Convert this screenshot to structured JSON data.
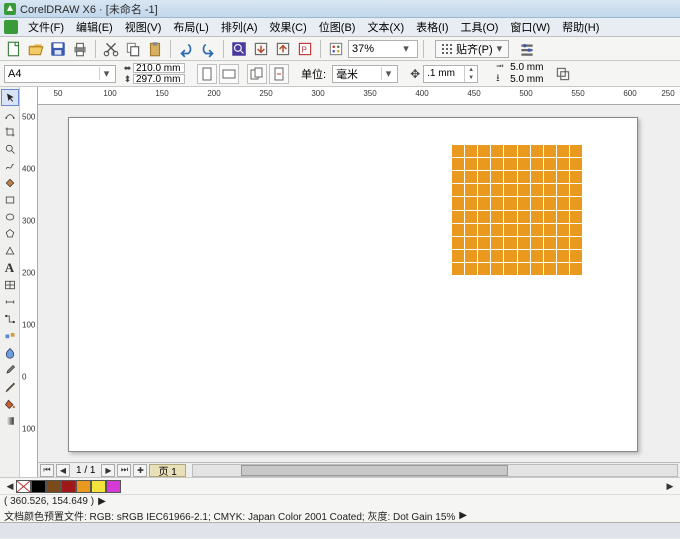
{
  "title": "CorelDRAW X6 · [未命名 -1]",
  "menus": [
    "文件(F)",
    "编辑(E)",
    "视图(V)",
    "布局(L)",
    "排列(A)",
    "效果(C)",
    "位图(B)",
    "文本(X)",
    "表格(I)",
    "工具(O)",
    "窗口(W)",
    "帮助(H)"
  ],
  "zoom": "37%",
  "align_label": "贴齐(P)",
  "paper_combo": "A4",
  "page_w": "210.0 mm",
  "page_h": "297.0 mm",
  "units_label": "单位:",
  "units_value": "毫米",
  "nudge": ".1 mm",
  "dup_x": "5.0 mm",
  "dup_y": "5.0 mm",
  "rulerH": [
    "50",
    "100",
    "150",
    "200",
    "250",
    "300",
    "350",
    "400",
    "450",
    "500",
    "550",
    "600",
    "250"
  ],
  "rulerHp": [
    58,
    110,
    162,
    214,
    266,
    318,
    370,
    422,
    474,
    526,
    578,
    620,
    660
  ],
  "rulerV": [
    "500",
    "400",
    "300",
    "200",
    "100",
    "0",
    "100"
  ],
  "rulerVp": [
    30,
    82,
    134,
    186,
    238,
    290,
    342
  ],
  "page_counter": "1 / 1",
  "page_tab": "页 1",
  "palette": [
    "#000000",
    "#7a4a1a",
    "#a01818",
    "#e8991e",
    "#f2e43a",
    "#d63ad6"
  ],
  "coords": "( 360.526, 154.649 )",
  "color_profile": "文档颜色预置文件: RGB: sRGB IEC61966-2.1; CMYK: Japan Color 2001 Coated; 灰度: Dot Gain 15%",
  "chart_data": null
}
